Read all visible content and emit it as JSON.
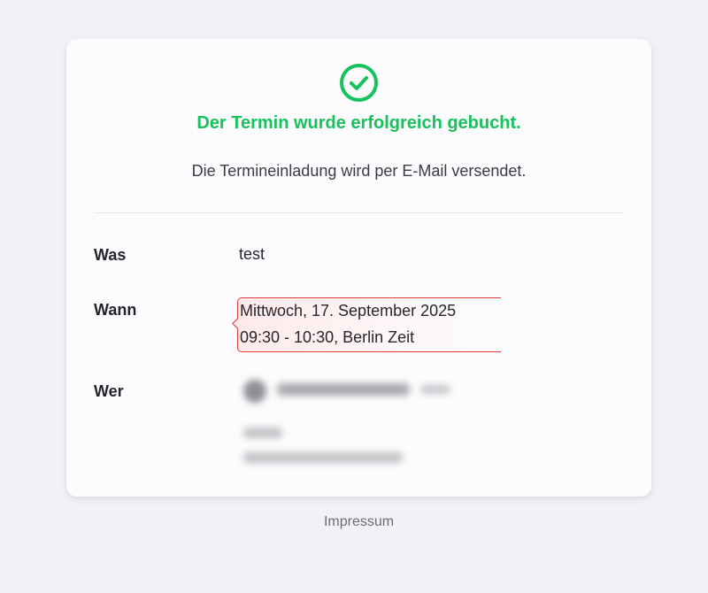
{
  "confirmation": {
    "icon": "check-circle-icon",
    "title": "Der Termin wurde erfolgreich gebucht.",
    "subtitle": "Die Termineinladung wird per E-Mail versendet."
  },
  "details": {
    "was": {
      "label": "Was",
      "value": "test"
    },
    "wann": {
      "label": "Wann",
      "date": "Mittwoch, 17. September 2025",
      "time": "09:30 - 10:30, Berlin Zeit"
    },
    "wer": {
      "label": "Wer",
      "content": "redacted"
    }
  },
  "footer": {
    "link": "Impressum"
  },
  "colors": {
    "success": "#17c25c",
    "highlight_border": "#e03c3c",
    "background": "#f2f2f6",
    "card": "#fcfbfd"
  }
}
